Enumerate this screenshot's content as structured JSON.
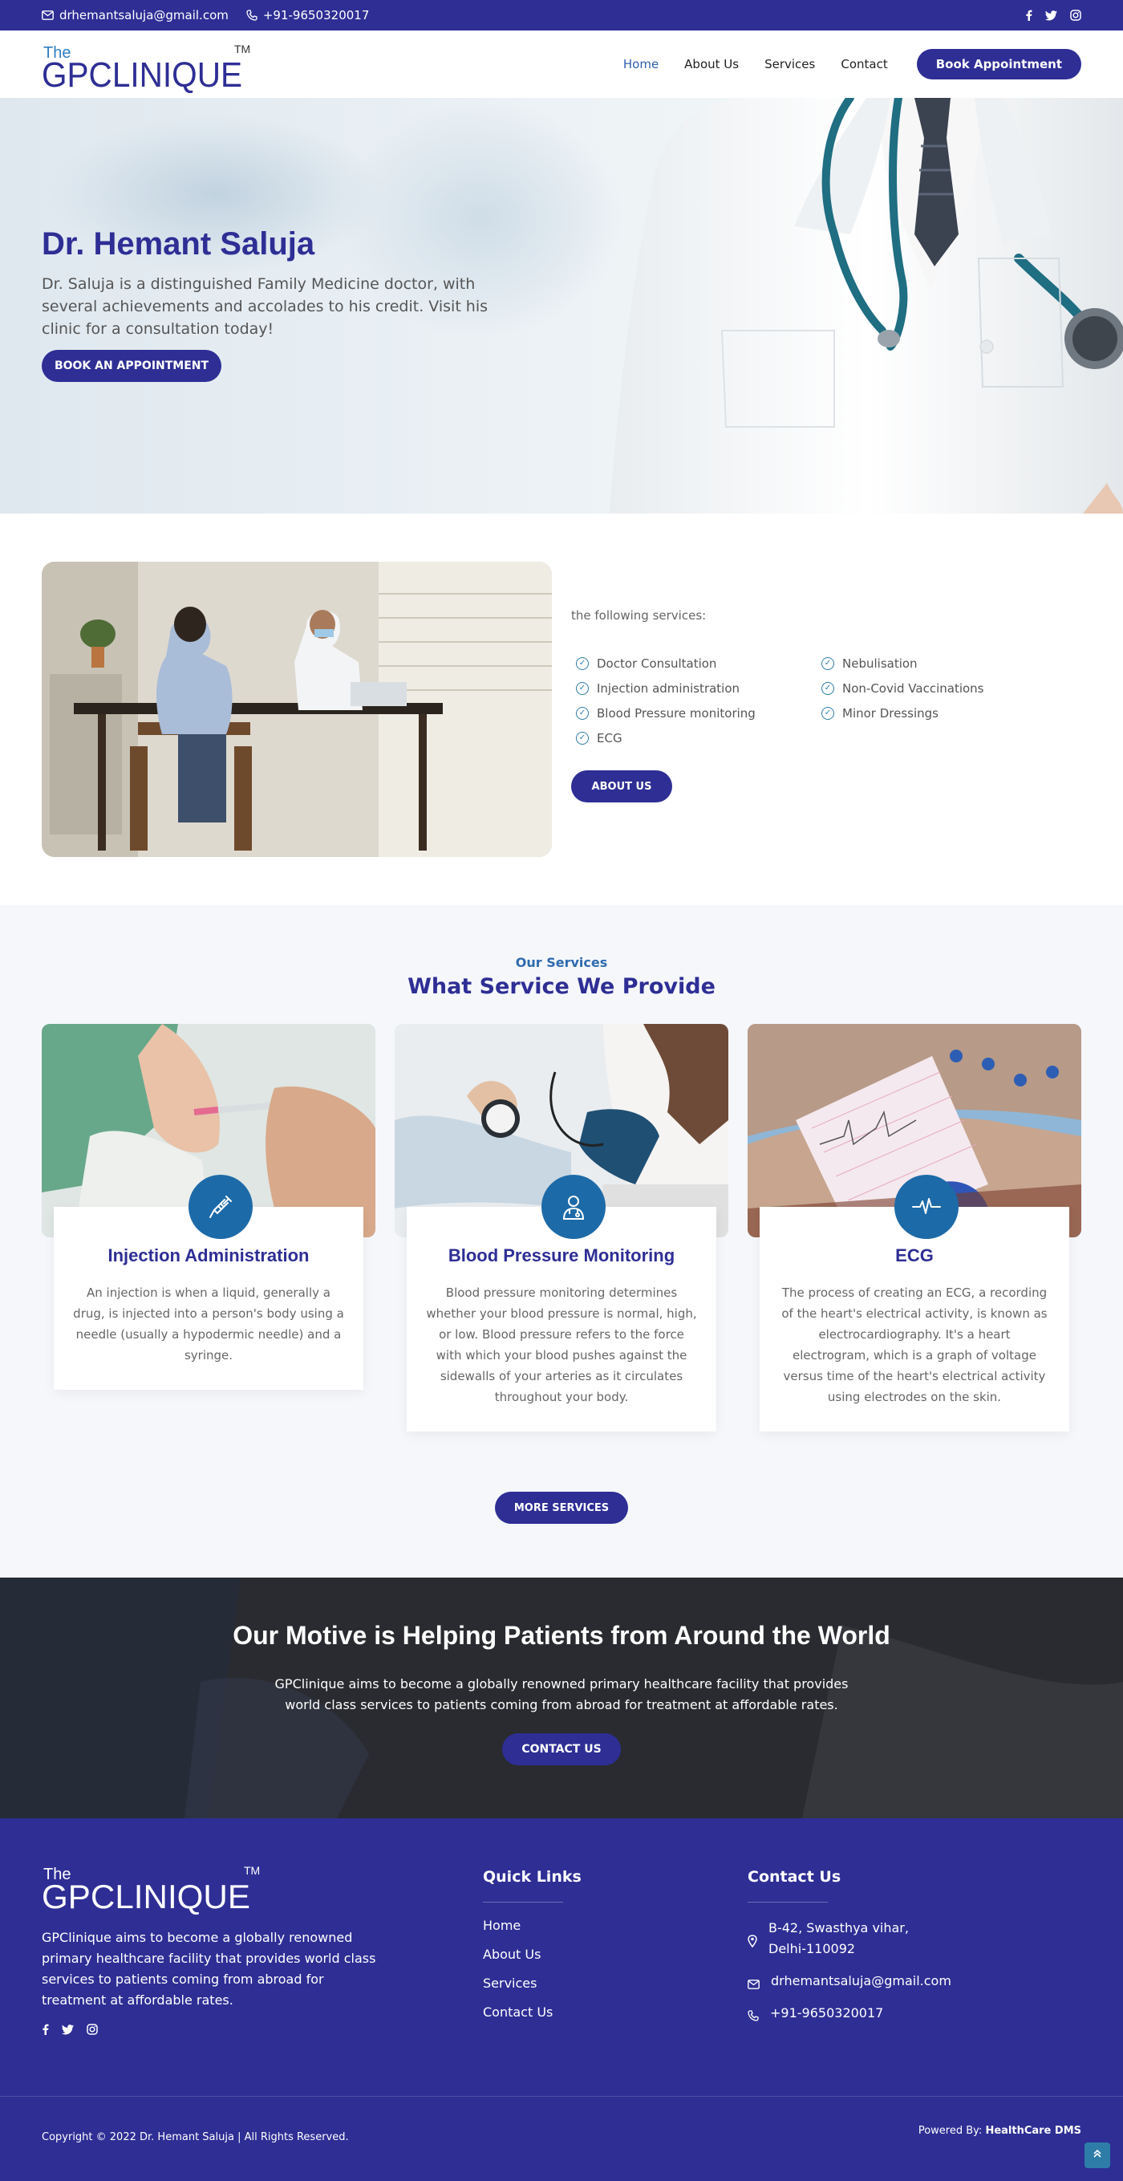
{
  "topbar": {
    "email": "drhemantsaluja@gmail.com",
    "phone": "+91-9650320017",
    "social_icons": [
      "facebook-icon",
      "twitter-icon",
      "instagram-icon"
    ]
  },
  "header": {
    "logo_the": "The",
    "logo_name": "GPCLINIQUE",
    "logo_tm": "TM",
    "nav": [
      "Home",
      "About Us",
      "Services",
      "Contact"
    ],
    "cta": "Book Appointment"
  },
  "hero": {
    "title": "Dr. Hemant Saluja",
    "text": "Dr. Saluja is a distinguished Family Medicine doctor, with several achievements and accolades to his credit. Visit his clinic for a consultation today!",
    "button": "BOOK AN APPOINTMENT"
  },
  "about": {
    "intro_tail": "the following services:",
    "services": [
      "Doctor Consultation",
      "Nebulisation",
      "Injection administration",
      "Non-Covid Vaccinations",
      "Blood Pressure monitoring",
      "Minor Dressings",
      "ECG"
    ],
    "button": "ABOUT US"
  },
  "services": {
    "kicker": "Our Services",
    "title": "What Service We Provide",
    "cards": [
      {
        "title": "Injection Administration",
        "text": "An injection is when a liquid, generally a drug, is injected into a person's body using a needle (usually a hypodermic needle) and a syringe.",
        "icon": "syringe-icon"
      },
      {
        "title": "Blood Pressure Monitoring",
        "text": "Blood pressure monitoring determines whether your blood pressure is normal, high, or low. Blood pressure refers to the force with which your blood pushes against the sidewalls of your arteries as it circulates throughout your body.",
        "icon": "doctor-icon"
      },
      {
        "title": "ECG",
        "text": "The process of creating an ECG, a recording of the heart's electrical activity, is known as electrocardiography. It's a heart electrogram, which is a graph of voltage versus time of the heart's electrical activity using electrodes on the skin.",
        "icon": "heartbeat-icon"
      }
    ],
    "button": "MORE SERVICES"
  },
  "motive": {
    "title": "Our Motive is Helping Patients from Around the World",
    "text": "GPClinique aims to become a globally renowned primary healthcare facility that provides world class services to patients coming from abroad for treatment at affordable rates.",
    "button": "CONTACT US"
  },
  "footer": {
    "logo_the": "The",
    "logo_name": "GPCLINIQUE",
    "logo_tm": "TM",
    "desc": "GPClinique aims to become a globally renowned primary healthcare facility that provides world class services to patients coming from abroad for treatment at affordable rates.",
    "quick_links_title": "Quick Links",
    "quick_links": [
      "Home",
      "About Us",
      "Services",
      "Contact Us"
    ],
    "contact_title": "Contact Us",
    "address_line1": "B-42, Swasthya vihar,",
    "address_line2": "Delhi-110092",
    "email": "drhemantsaluja@gmail.com",
    "phone": "+91-9650320017",
    "copyright": "Copyright © 2022 Dr. Hemant Saluja | All Rights Reserved.",
    "powered_label": "Powered By: ",
    "powered_name": "HealthCare DMS"
  },
  "colors": {
    "primary": "#2e2e95",
    "accent": "#1d6aa8",
    "link_active": "#2f5fae"
  }
}
